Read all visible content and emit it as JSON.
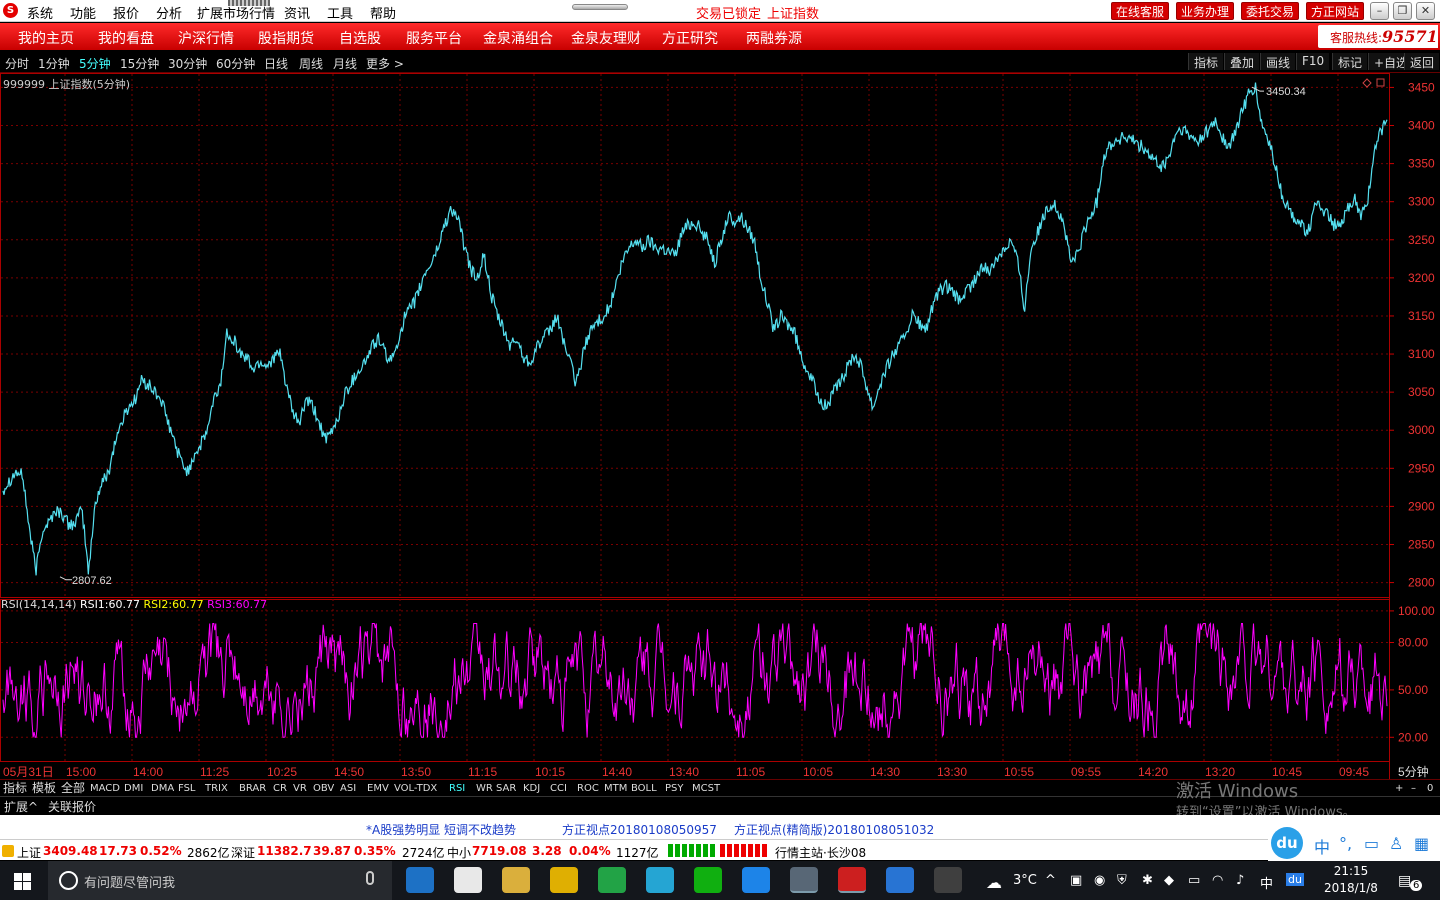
{
  "menu": {
    "logo": "S",
    "items": [
      "系统",
      "功能",
      "报价",
      "分析",
      "扩展市场行情",
      "资讯",
      "工具",
      "帮助"
    ],
    "status": [
      "交易已锁定",
      "上证指数"
    ],
    "right_buttons": [
      "在线客服",
      "业务办理",
      "委托交易",
      "方正网站"
    ],
    "window_controls": [
      "–",
      "❐",
      "✕"
    ]
  },
  "nav": {
    "items": [
      "我的主页",
      "我的看盘",
      "沪深行情",
      "股指期货",
      "自选股",
      "服务平台",
      "金泉涌组合",
      "金泉友理财",
      "方正研究",
      "两融券源"
    ],
    "hotline_label": "客服热线:",
    "hotline_number": "95571"
  },
  "periods": {
    "items": [
      "分时",
      "1分钟",
      "5分钟",
      "15分钟",
      "30分钟",
      "60分钟",
      "日线",
      "周线",
      "月线",
      "更多 >"
    ],
    "active": "5分钟",
    "tools": [
      "指标",
      "叠加",
      "画线",
      "F10",
      "标记",
      "+自选",
      "返回"
    ]
  },
  "chart_title": "999999 上证指数(5分钟)",
  "rsi": {
    "label": "RSI(14,14,14)",
    "rsi1_label": "RSI1:",
    "rsi1": "60.77",
    "rsi2_label": "RSI2:",
    "rsi2": "60.77",
    "rsi3_label": "RSI3:",
    "rsi3": "60.77"
  },
  "indicator_tabs": [
    "指标",
    "模板",
    "全部",
    "MACD",
    "DMI",
    "DMA",
    "FSL",
    "TRIX",
    "BRAR",
    "CR",
    "VR",
    "OBV",
    "ASI",
    "EMV",
    "VOL-TDX",
    "RSI",
    "WR",
    "SAR",
    "KDJ",
    "CCI",
    "ROC",
    "MTM",
    "BOLL",
    "PSY",
    "MCST"
  ],
  "indicator_active": "RSI",
  "indicator_right": [
    "+",
    "–",
    "0"
  ],
  "extend": [
    "扩展^",
    "关联报价"
  ],
  "watermark": [
    "激活 Windows",
    "转到“设置”以激活 Windows。"
  ],
  "news": [
    "*A股强势明显  短调不改趋势",
    "方正视点20180108050957",
    "方正视点(精简版)20180108051032"
  ],
  "indexes": {
    "sh_label": "上证",
    "sh_value": "3409.48",
    "sh_change": "17.73",
    "sh_pct": "0.52%",
    "sh_amount": "2862亿",
    "sz_label": "深证",
    "sz_value": "11382.7",
    "sz_change": "39.87",
    "sz_pct": "0.35%",
    "sz_amount": "2724亿",
    "zx_label": "中小",
    "zx_value": "7719.08",
    "zx_change": "3.28",
    "zx_pct": "0.04%",
    "zx_amount": "1127亿",
    "server": "行情主站·长沙08"
  },
  "ime": {
    "logo": "du",
    "icons": [
      "中",
      "°,",
      "▭",
      "♙",
      "▦"
    ]
  },
  "taskbar": {
    "search_placeholder": "有问题尽管问我",
    "weather": "3°C",
    "ime_lang": "中",
    "time": "21:15",
    "date": "2018/1/8",
    "notifications": "6",
    "apps": [
      {
        "name": "edge-icon",
        "color": "#1e7bd8"
      },
      {
        "name": "store-icon",
        "color": "#ffffff"
      },
      {
        "name": "explorer-icon",
        "color": "#f0c040"
      },
      {
        "name": "browser-360-icon",
        "color": "#f5c000"
      },
      {
        "name": "green-app-icon",
        "color": "#24b34b"
      },
      {
        "name": "player-icon",
        "color": "#27b5e8"
      },
      {
        "name": "iqiyi-icon",
        "color": "#10c010"
      },
      {
        "name": "ie-icon",
        "color": "#1e90ff"
      },
      {
        "name": "ftp-icon",
        "color": "#607080"
      },
      {
        "name": "founder-icon",
        "color": "#e02020"
      },
      {
        "name": "wps-icon",
        "color": "#2a7ee8"
      },
      {
        "name": "terminal-icon",
        "color": "#444444"
      }
    ]
  },
  "chart_data": [
    {
      "type": "line",
      "title": "999999 上证指数(5分钟)",
      "y_ticks": [
        "3450",
        "3400",
        "3350",
        "3300",
        "3250",
        "3200",
        "3150",
        "3100",
        "3050",
        "3000",
        "2950",
        "2900",
        "2850",
        "2800"
      ],
      "ylim": [
        2785,
        3465
      ],
      "x_ticks": [
        "05月31日",
        "15:00",
        "14:00",
        "11:25",
        "10:25",
        "14:50",
        "13:50",
        "11:15",
        "10:15",
        "14:40",
        "13:40",
        "11:05",
        "10:05",
        "14:30",
        "13:30",
        "10:55",
        "09:55",
        "14:20",
        "13:20",
        "10:45",
        "09:45"
      ],
      "period_label": "5分钟",
      "annotations": [
        {
          "label": "3450.34",
          "value": 3450.34
        },
        {
          "label": "2807.62",
          "value": 2807.62
        }
      ],
      "series": [
        {
          "color": "#55e0f0",
          "values": [
            2922,
            2935,
            2945,
            2940,
            2870,
            2815,
            2870,
            2880,
            2895,
            2890,
            2875,
            2880,
            2895,
            2812,
            2905,
            2930,
            2945,
            2985,
            3010,
            3030,
            3040,
            3065,
            3060,
            3050,
            3040,
            3010,
            2985,
            2960,
            2945,
            2968,
            2980,
            3000,
            3040,
            3060,
            3130,
            3120,
            3100,
            3095,
            3080,
            3090,
            3085,
            3095,
            3100,
            3060,
            3020,
            3010,
            3040,
            3030,
            3010,
            2985,
            3000,
            3020,
            3050,
            3065,
            3080,
            3090,
            3110,
            3120,
            3100,
            3090,
            3120,
            3150,
            3160,
            3180,
            3205,
            3220,
            3240,
            3270,
            3290,
            3280,
            3240,
            3210,
            3200,
            3230,
            3180,
            3150,
            3130,
            3110,
            3120,
            3095,
            3090,
            3110,
            3120,
            3130,
            3150,
            3120,
            3090,
            3060,
            3100,
            3130,
            3140,
            3150,
            3160,
            3190,
            3220,
            3240,
            3250,
            3240,
            3250,
            3240,
            3240,
            3235,
            3230,
            3260,
            3270,
            3275,
            3260,
            3250,
            3220,
            3250,
            3280,
            3275,
            3280,
            3265,
            3250,
            3200,
            3165,
            3130,
            3150,
            3140,
            3130,
            3100,
            3080,
            3060,
            3040,
            3030,
            3050,
            3060,
            3080,
            3100,
            3090,
            3060,
            3030,
            3060,
            3080,
            3100,
            3110,
            3130,
            3150,
            3140,
            3130,
            3160,
            3180,
            3190,
            3180,
            3170,
            3180,
            3190,
            3205,
            3215,
            3210,
            3230,
            3240,
            3250,
            3220,
            3160,
            3240,
            3260,
            3280,
            3300,
            3290,
            3270,
            3220,
            3230,
            3260,
            3280,
            3300,
            3360,
            3375,
            3380,
            3385,
            3380,
            3378,
            3370,
            3360,
            3350,
            3345,
            3360,
            3390,
            3395,
            3385,
            3380,
            3385,
            3395,
            3405,
            3385,
            3370,
            3390,
            3420,
            3440,
            3450,
            3400,
            3380,
            3350,
            3310,
            3290,
            3280,
            3270,
            3260,
            3290,
            3295,
            3280,
            3270,
            3265,
            3290,
            3305,
            3280,
            3300,
            3360,
            3390,
            3412
          ]
        }
      ]
    },
    {
      "type": "line",
      "title": "RSI(14,14,14)",
      "y_ticks": [
        "100.00",
        "80.00",
        "50.00",
        "20.00"
      ],
      "ylim": [
        5,
        105
      ],
      "series": [
        {
          "name": "RSI1",
          "color": "#ffffff",
          "value_label": "60.77"
        },
        {
          "name": "RSI2",
          "color": "#ffff00",
          "value_label": "60.77"
        },
        {
          "name": "RSI3",
          "color": "#ff00ff",
          "value_label": "60.77",
          "level": 60.77,
          "range": [
            20,
            100
          ]
        }
      ]
    }
  ]
}
